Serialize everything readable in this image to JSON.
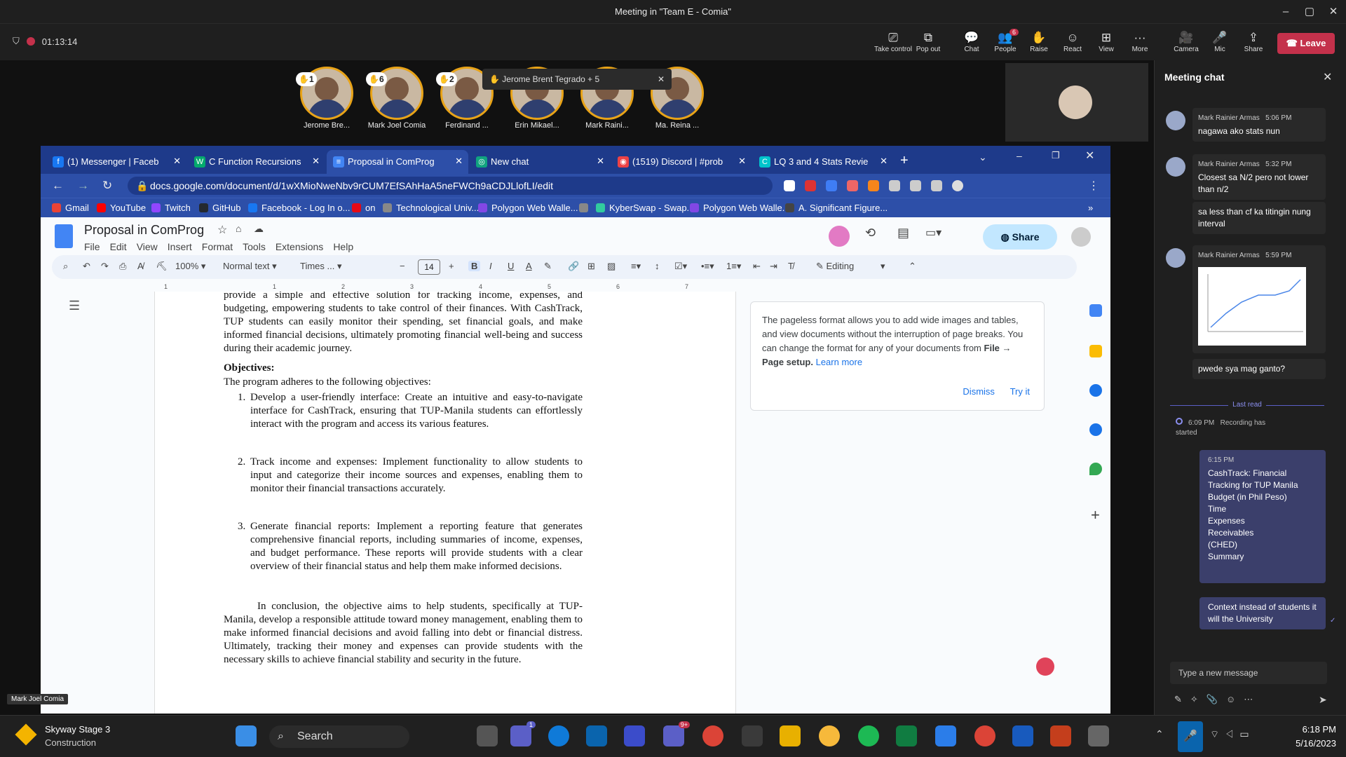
{
  "window": {
    "title": "Meeting in \"Team E - Comia\""
  },
  "toolbar": {
    "timer": "01:13:14",
    "buttons": [
      "Take control",
      "Pop out",
      "Chat",
      "People",
      "Raise",
      "React",
      "View",
      "More",
      "Camera",
      "Mic",
      "Share"
    ],
    "people_badge": "6",
    "leave": "Leave"
  },
  "gallery": {
    "participants": [
      {
        "name": "Jerome Bre...",
        "hand": "1"
      },
      {
        "name": "Mark Joel Comia",
        "hand": "6"
      },
      {
        "name": "Ferdinand ...",
        "hand": "2"
      },
      {
        "name": "Erin Mikael...",
        "hand": ""
      },
      {
        "name": "Mark Raini...",
        "hand": ""
      },
      {
        "name": "Ma. Reina ...",
        "hand": ""
      }
    ],
    "toast": "Jerome Brent Tegrado + 5",
    "speaker_label": "Mark Joel Comia"
  },
  "browser": {
    "tabs": [
      {
        "label": "(1) Messenger | Faceb",
        "icon": "facebook-icon",
        "color": "#1877f2"
      },
      {
        "label": "C Function Recursions",
        "icon": "w3schools-icon",
        "color": "#04aa6d"
      },
      {
        "label": "Proposal in ComProg",
        "icon": "docs-icon",
        "color": "#4285f4"
      },
      {
        "label": "New chat",
        "icon": "chatgpt-icon",
        "color": "#10a37f"
      },
      {
        "label": "(1519) Discord | #prob",
        "icon": "discord-icon",
        "color": "#ed4245"
      },
      {
        "label": "LQ 3 and 4 Stats Revie",
        "icon": "canva-icon",
        "color": "#00c4cc"
      }
    ],
    "url": "docs.google.com/document/d/1wXMioNweNbv9rCUM7EfSAhHaA5neFWCh9aCDJLlofLI/edit",
    "bookmarks": [
      {
        "label": "Gmail",
        "color": "#ea4335"
      },
      {
        "label": "YouTube",
        "color": "#ff0000"
      },
      {
        "label": "Twitch",
        "color": "#9146ff"
      },
      {
        "label": "GitHub",
        "color": "#24292f"
      },
      {
        "label": "Facebook - Log In o...",
        "color": "#1877f2"
      },
      {
        "label": "on",
        "color": "#e50914"
      },
      {
        "label": "Technological Univ...",
        "color": "#888888"
      },
      {
        "label": "Polygon Web Walle...",
        "color": "#8247e5"
      },
      {
        "label": "",
        "color": "#888888"
      },
      {
        "label": "KyberSwap - Swap...",
        "color": "#31cb9e"
      },
      {
        "label": "Polygon Web Walle...",
        "color": "#8247e5"
      },
      {
        "label": "A. Significant Figure...",
        "color": "#444444"
      }
    ]
  },
  "docs": {
    "title": "Proposal in ComProg",
    "menu": [
      "File",
      "Edit",
      "View",
      "Insert",
      "Format",
      "Tools",
      "Extensions",
      "Help"
    ],
    "share": "Share",
    "zoom": "100%",
    "style": "Normal text",
    "font": "Times ...",
    "font_size": "14",
    "mode": "Editing",
    "ruler": [
      "1",
      "1",
      "2",
      "3",
      "4",
      "5",
      "6",
      "7"
    ],
    "para1": "provide a simple and effective solution for tracking income, expenses, and budgeting, empowering students to take control of their finances. With CashTrack, TUP students can easily monitor their spending, set financial goals, and make informed financial decisions, ultimately promoting financial well-being and success during their academic journey.",
    "objectives_heading": "Objectives:",
    "objectives_intro": "The program adheres to the following objectives:",
    "items": [
      {
        "n": "1.",
        "text": "Develop a user-friendly interface: Create an intuitive and easy-to-navigate interface for CashTrack, ensuring that TUP-Manila students can effortlessly interact with the program and access its various features."
      },
      {
        "n": "2.",
        "text": "Track income and expenses: Implement functionality to allow students to input and categorize their income sources and expenses, enabling them to monitor their financial transactions accurately."
      },
      {
        "n": "3.",
        "text": "Generate financial reports: Implement a reporting feature that generates comprehensive financial reports, including summaries of income, expenses, and budget performance. These reports will provide students with a clear overview of their financial status and help them make informed decisions."
      }
    ],
    "conclusion": "In conclusion, the objective aims to help students, specifically at TUP-Manila, develop a responsible attitude toward money management, enabling them to make informed financial decisions and avoid falling into debt or financial distress. Ultimately, tracking their money and expenses can provide students with the necessary skills to achieve financial stability and security in the future.",
    "tip": "The pageless format allows you to add wide images and tables, and view documents without the interruption of page breaks. You can change the format for any of your documents from",
    "tip_bold": "File → Page setup.",
    "tip_link": "Learn more",
    "dismiss": "Dismiss",
    "try_it": "Try it"
  },
  "chat": {
    "title": "Meeting chat",
    "messages": [
      {
        "author": "Mark Rainier Armas",
        "time": "5:06 PM",
        "text": "nagawa ako stats nun"
      },
      {
        "author": "Mark Rainier Armas",
        "time": "5:32 PM",
        "text": "Closest sa N/2 pero not lower than n/2"
      },
      {
        "author": "",
        "time": "",
        "text": "sa less than cf ka titingin nung interval"
      },
      {
        "author": "Mark Rainier Armas",
        "time": "5:59 PM",
        "text": ""
      },
      {
        "author": "",
        "time": "",
        "text": "pwede sya mag ganto?"
      }
    ],
    "last_read": "Last read",
    "system": {
      "time": "6:09 PM",
      "text": "Recording has started"
    },
    "mine_time": "6:15 PM",
    "mine_lines": [
      "CashTrack: Financial Tracking for TUP Manila",
      "Budget (in Phil Peso)",
      "Time",
      "Expenses",
      "Receivables",
      " (CHED)",
      "Summary"
    ],
    "mine2": "Context instead of students it will the University",
    "input_placeholder": "Type a new message"
  },
  "taskbar": {
    "weather_title": "Skyway Stage 3",
    "weather_sub": "Construction",
    "search": "Search",
    "teams_badge": "9+",
    "chat_badge": "1",
    "time": "6:18 PM",
    "date": "5/16/2023"
  }
}
